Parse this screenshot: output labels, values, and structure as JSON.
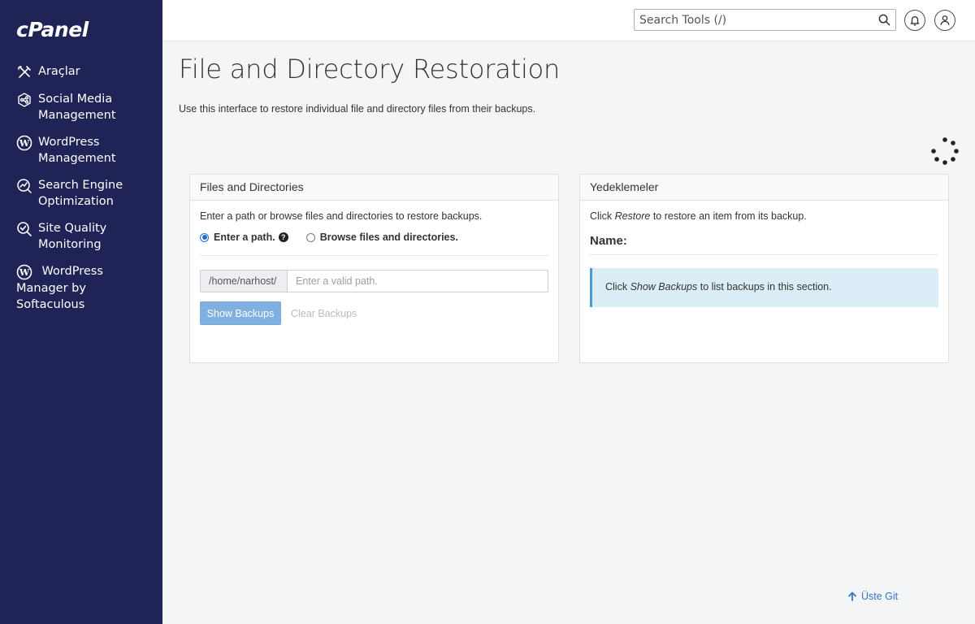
{
  "brand": {
    "logo_text": "cPanel"
  },
  "sidebar": {
    "items": [
      {
        "label": "Araçlar",
        "icon": "tools-icon"
      },
      {
        "label": "Social Media Management",
        "icon": "social-media-icon"
      },
      {
        "label": "WordPress Management",
        "icon": "wordpress-icon"
      },
      {
        "label": "Search Engine Optimization",
        "icon": "seo-chart-icon"
      },
      {
        "label": "Site Quality Monitoring",
        "icon": "magnifier-check-icon"
      },
      {
        "label": "WordPress Manager by Softaculous",
        "icon": "wordpress-icon"
      }
    ]
  },
  "topbar": {
    "search_placeholder": "Search Tools (/)"
  },
  "page": {
    "title": "File and Directory Restoration",
    "intro": "Use this interface to restore individual file and directory files from their backups."
  },
  "files_panel": {
    "heading": "Files and Directories",
    "description": "Enter a path or browse files and directories to restore backups.",
    "radio_path": "Enter a path.",
    "radio_browse": "Browse files and directories.",
    "selected": "Enter a path.",
    "path_prefix": "/home/narhost/",
    "path_placeholder": "Enter a valid path.",
    "path_value": "",
    "show_button": "Show Backups",
    "clear_button": "Clear Backups"
  },
  "backups_panel": {
    "heading": "Yedeklemeler",
    "instr_pre": "Click ",
    "instr_em": "Restore",
    "instr_post": " to restore an item from its backup.",
    "name_label": "Name:",
    "info_pre": "Click ",
    "info_em": "Show Backups",
    "info_post": " to list backups in this section."
  },
  "footer": {
    "to_top": "Üste Git"
  },
  "colors": {
    "sidebar": "#1f2355",
    "accent": "#7fb0e0",
    "info_bg": "#dbeef8",
    "link": "#2f75c4"
  }
}
